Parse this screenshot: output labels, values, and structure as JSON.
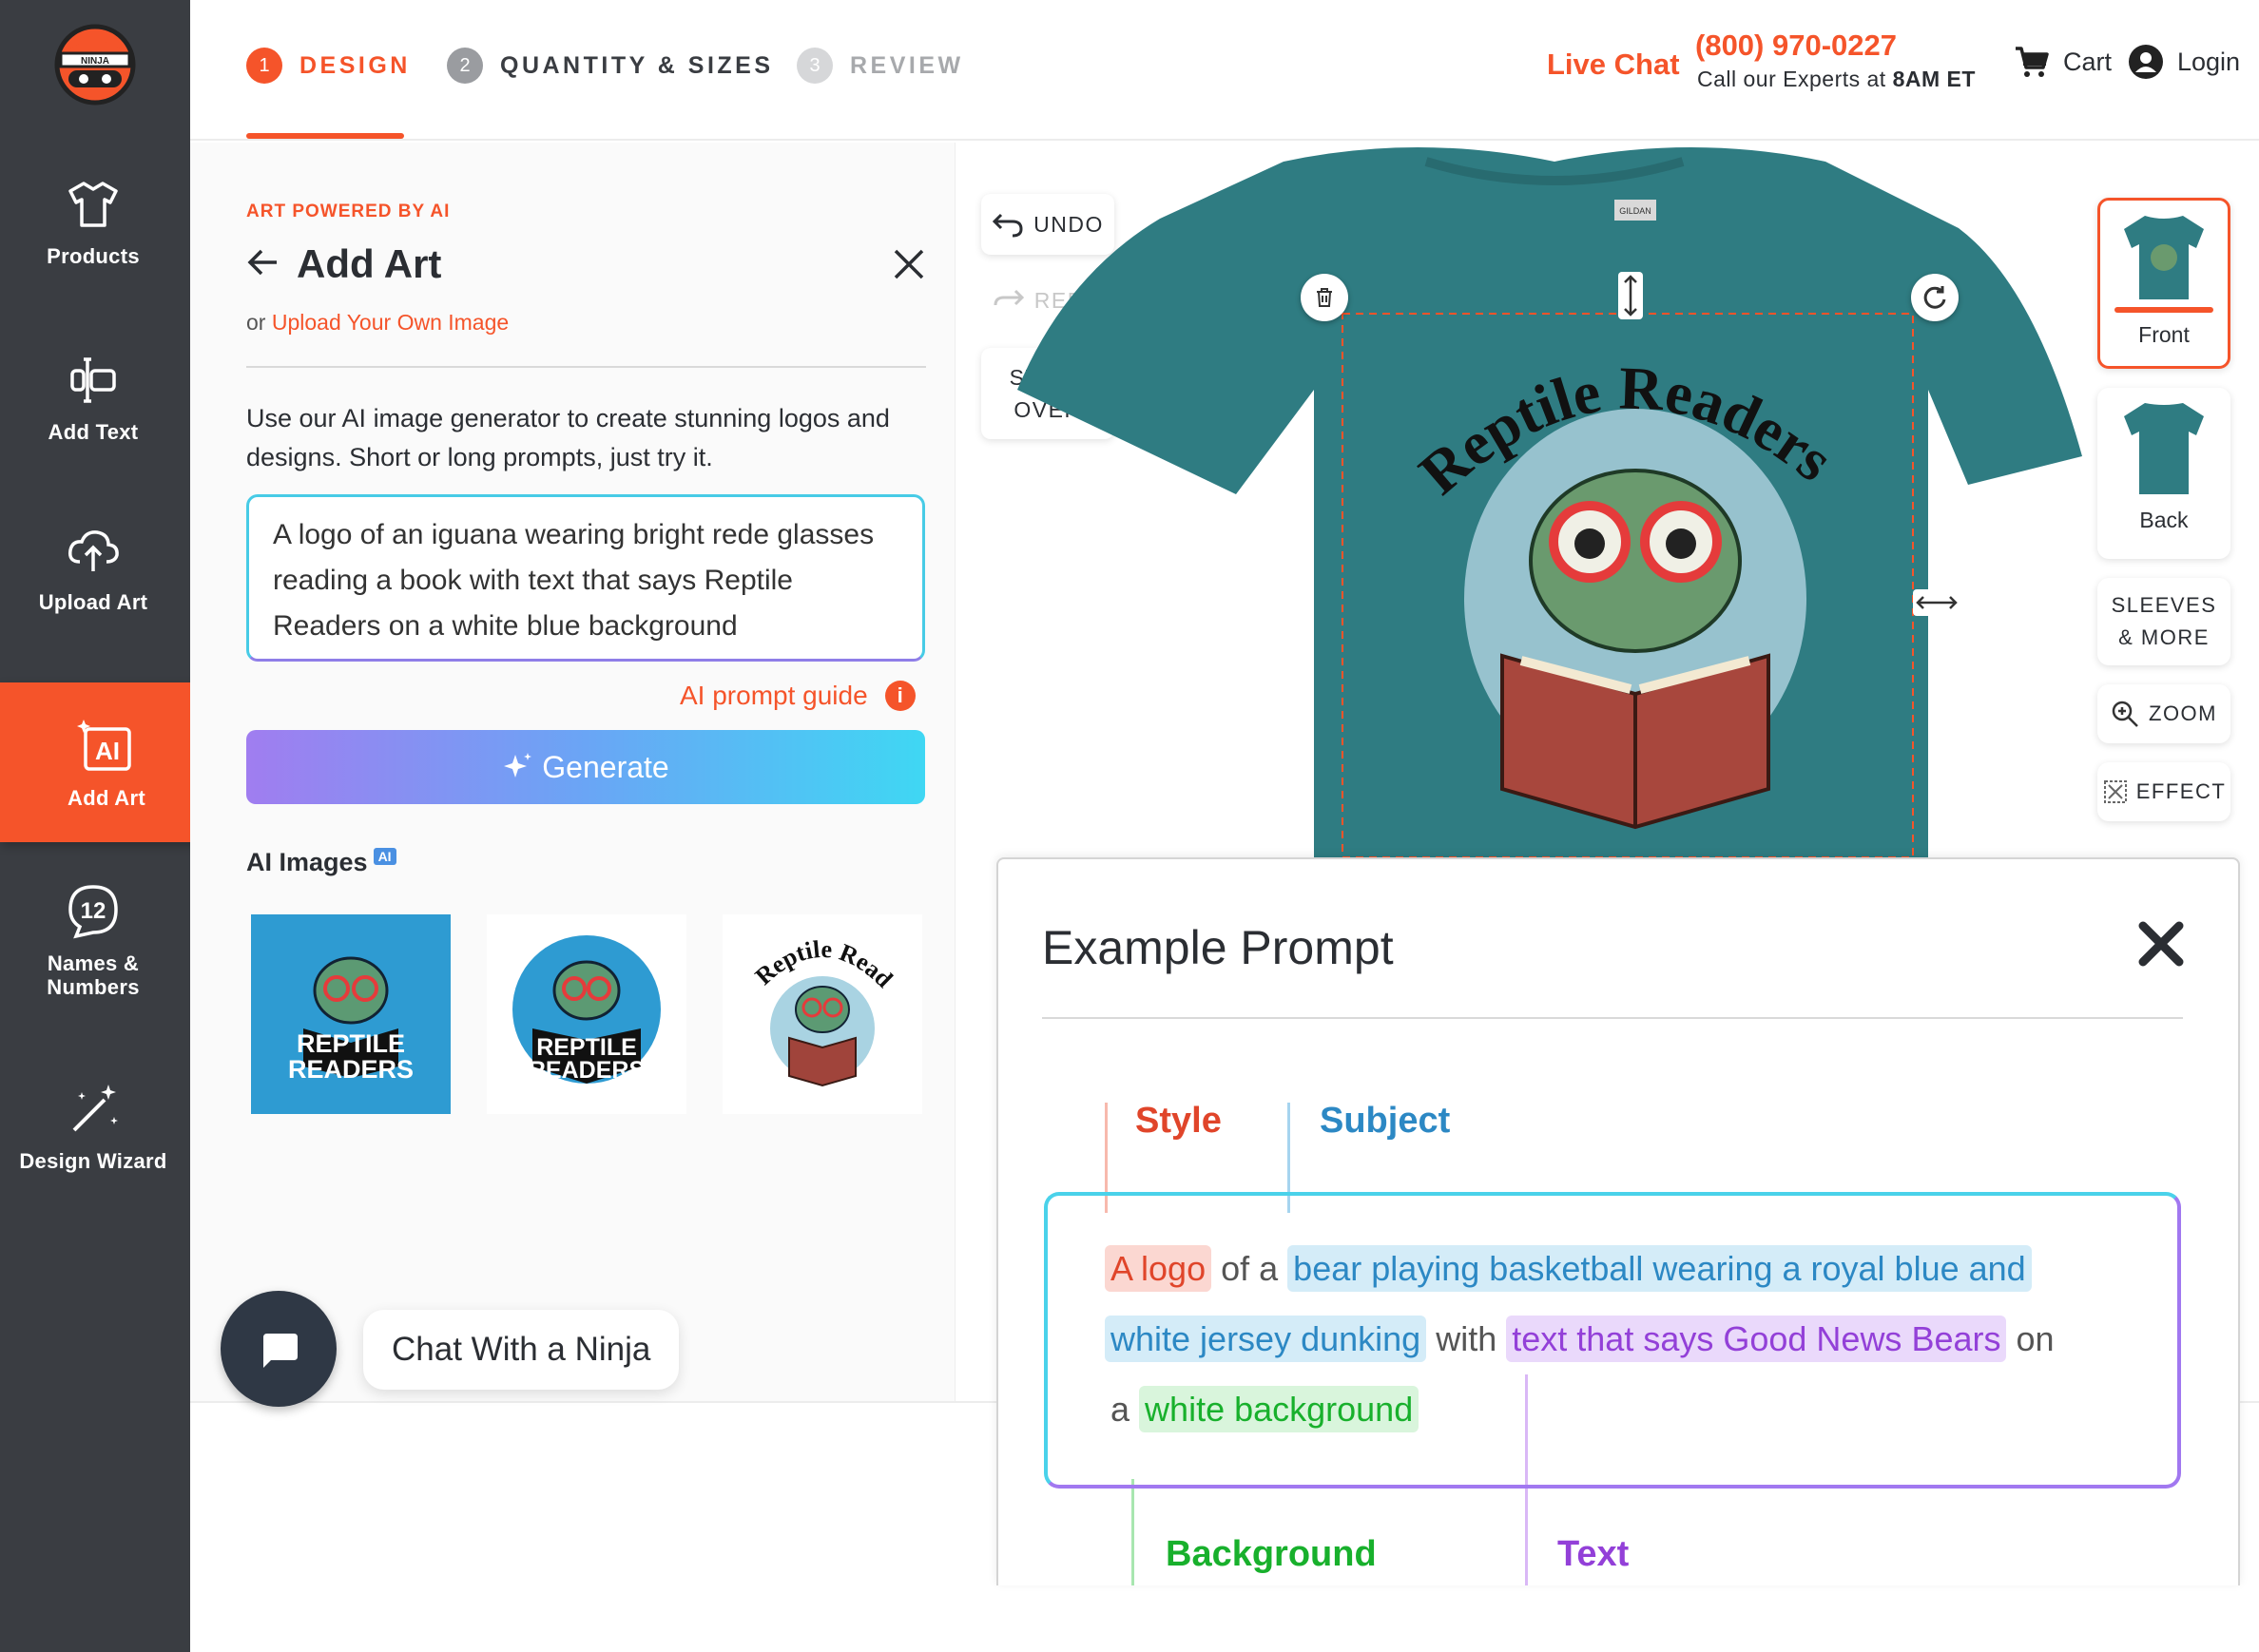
{
  "brand": {
    "logo_text": "NINJA",
    "accent": "#f5542a",
    "sidebar_bg": "#3a3d42"
  },
  "sidebar": {
    "items": [
      {
        "label": "Products",
        "icon": "tshirt-icon"
      },
      {
        "label": "Add Text",
        "icon": "text-cursor-icon"
      },
      {
        "label": "Upload Art",
        "icon": "cloud-upload-icon"
      },
      {
        "label": "Add Art",
        "icon": "ai-art-icon",
        "active": true
      },
      {
        "label": "Names & Numbers",
        "icon": "number-badge-icon",
        "badge": "12"
      },
      {
        "label": "Design Wizard",
        "icon": "magic-wand-icon"
      }
    ]
  },
  "steps": [
    {
      "num": "1",
      "label": "DESIGN",
      "state": "active"
    },
    {
      "num": "2",
      "label": "QUANTITY & SIZES",
      "state": "upcoming"
    },
    {
      "num": "3",
      "label": "REVIEW",
      "state": "disabled"
    }
  ],
  "header": {
    "live_chat": "Live Chat",
    "phone": "(800) 970-0227",
    "experts_prefix": "Call our Experts at ",
    "experts_time": "8AM ET",
    "cart": "Cart",
    "login": "Login"
  },
  "panel": {
    "powered": "ART POWERED BY AI",
    "title": "Add Art",
    "upload_prefix": "or ",
    "upload_link": "Upload Your Own Image",
    "description": "Use our AI image generator to create stunning logos and designs. Short or long prompts, just try it.",
    "prompt_value": "A logo of an iguana wearing bright rede glasses reading a book with text that says Reptile Readers on a white blue background",
    "prompt_guide": "AI prompt guide",
    "info": "i",
    "generate": "Generate",
    "ai_images_label": "AI Images",
    "ai_badge": "AI",
    "thumbs": [
      "REPTILE READERS",
      "REPTILE READERS",
      "Reptile Readers"
    ]
  },
  "canvas": {
    "undo": "UNDO",
    "redo": "REDO",
    "start_over": [
      "START",
      "OVER"
    ],
    "design_text": "Reptile Readers",
    "shirt_color": "#2f7c82",
    "tag": "GILDAN",
    "views": [
      {
        "label": "Front",
        "active": true
      },
      {
        "label": "Back",
        "active": false
      }
    ],
    "sleeves": [
      "SLEEVES",
      "& MORE"
    ],
    "zoom": "ZOOM",
    "effect": "EFFECT"
  },
  "chat": {
    "label": "Chat With a Ninja"
  },
  "example_prompt": {
    "title": "Example Prompt",
    "labels": {
      "style": "Style",
      "subject": "Subject",
      "background": "Background",
      "text": "Text"
    },
    "line1": {
      "style": "A logo",
      "of": "of a",
      "subject1": "bear playing basketball wearing a royal blue and"
    },
    "line2": {
      "subject2": "white jersey dunking",
      "with": "with",
      "text": "text that says Good News Bears",
      "on": "on"
    },
    "line3": {
      "a": "a",
      "background": "white background"
    }
  }
}
